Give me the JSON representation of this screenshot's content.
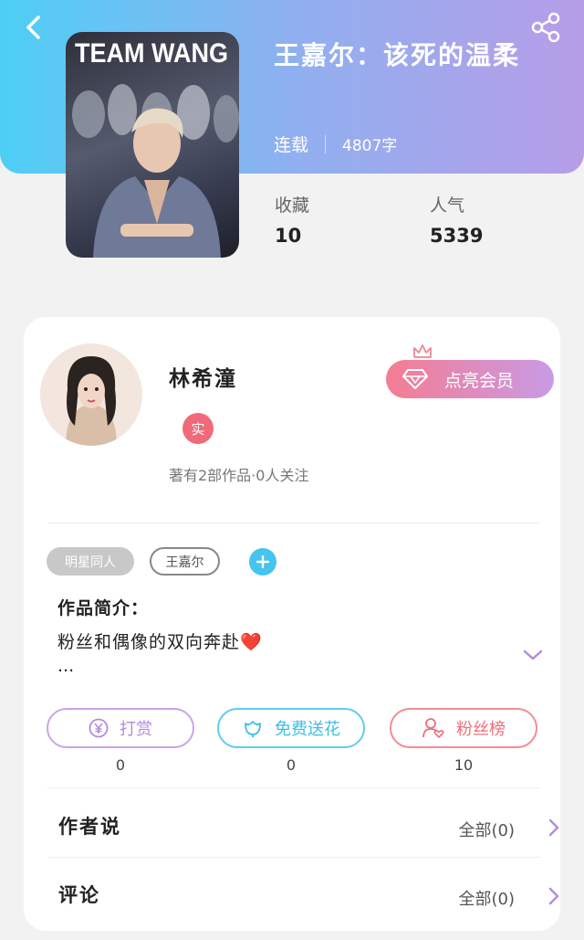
{
  "header": {
    "book_title": "王嘉尔：该死的温柔",
    "status": "连载",
    "word_count": "4807字",
    "cover_text": "TEAM WANG",
    "stats": [
      {
        "label": "收藏",
        "value": "10"
      },
      {
        "label": "人气",
        "value": "5339"
      }
    ]
  },
  "author": {
    "name": "林希潼",
    "badge": "实",
    "meta": "著有2部作品·0人关注",
    "vip_button": "点亮会员"
  },
  "tags": [
    {
      "label": "明星同人"
    },
    {
      "label": "王嘉尔"
    }
  ],
  "intro": {
    "title": "作品简介：",
    "text": "粉丝和偶像的双向奔赴❤️",
    "more": "..."
  },
  "actions": [
    {
      "label": "打赏",
      "count": "0",
      "color": "#c59be0"
    },
    {
      "label": "免费送花",
      "count": "0",
      "color": "#4ec8ee"
    },
    {
      "label": "粉丝榜",
      "count": "10",
      "color": "#f07a86"
    }
  ],
  "rows": [
    {
      "title": "作者说",
      "right": "全部(0)"
    },
    {
      "title": "评论",
      "right": "全部(0)"
    }
  ],
  "icons": {
    "back": "back-arrow-icon",
    "share": "share-icon",
    "diamond": "diamond-icon",
    "crown": "crown-icon",
    "yen": "yen-coin-icon",
    "flower": "flower-icon",
    "fans": "user-heart-icon",
    "chevron_down": "chevron-down-icon",
    "chevron_right": "chevron-right-icon"
  }
}
